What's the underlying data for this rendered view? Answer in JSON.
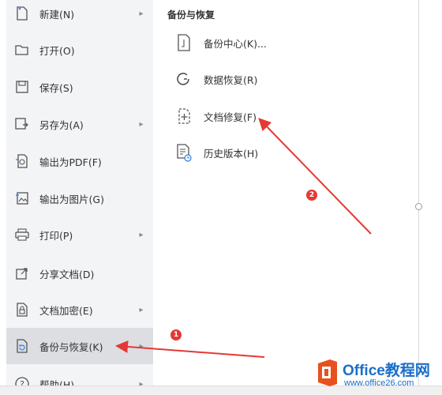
{
  "menu": {
    "items": [
      {
        "label": "新建(N)",
        "icon": "new-file-icon",
        "has_submenu": true
      },
      {
        "label": "打开(O)",
        "icon": "folder-open-icon",
        "has_submenu": false
      },
      {
        "label": "保存(S)",
        "icon": "save-icon",
        "has_submenu": false
      },
      {
        "label": "另存为(A)",
        "icon": "save-as-icon",
        "has_submenu": true
      },
      {
        "label": "输出为PDF(F)",
        "icon": "pdf-export-icon",
        "has_submenu": false
      },
      {
        "label": "输出为图片(G)",
        "icon": "image-export-icon",
        "has_submenu": false
      },
      {
        "label": "打印(P)",
        "icon": "print-icon",
        "has_submenu": true
      },
      {
        "label": "分享文档(D)",
        "icon": "share-icon",
        "has_submenu": false
      },
      {
        "label": "文档加密(E)",
        "icon": "encrypt-icon",
        "has_submenu": true
      },
      {
        "label": "备份与恢复(K)",
        "icon": "backup-restore-icon",
        "has_submenu": true,
        "selected": true
      },
      {
        "label": "帮助(H)",
        "icon": "help-icon",
        "has_submenu": true
      }
    ]
  },
  "submenu": {
    "title": "备份与恢复",
    "items": [
      {
        "label": "备份中心(K)...",
        "icon": "backup-center-icon"
      },
      {
        "label": "数据恢复(R)",
        "icon": "data-recovery-icon"
      },
      {
        "label": "文档修复(F)",
        "icon": "document-repair-icon"
      },
      {
        "label": "历史版本(H)",
        "icon": "history-version-icon"
      }
    ]
  },
  "annotations": {
    "marker_1": "1",
    "marker_2": "2",
    "color": "#e53935"
  },
  "watermark": {
    "title": "Office教程网",
    "url": "www.office26.com"
  }
}
